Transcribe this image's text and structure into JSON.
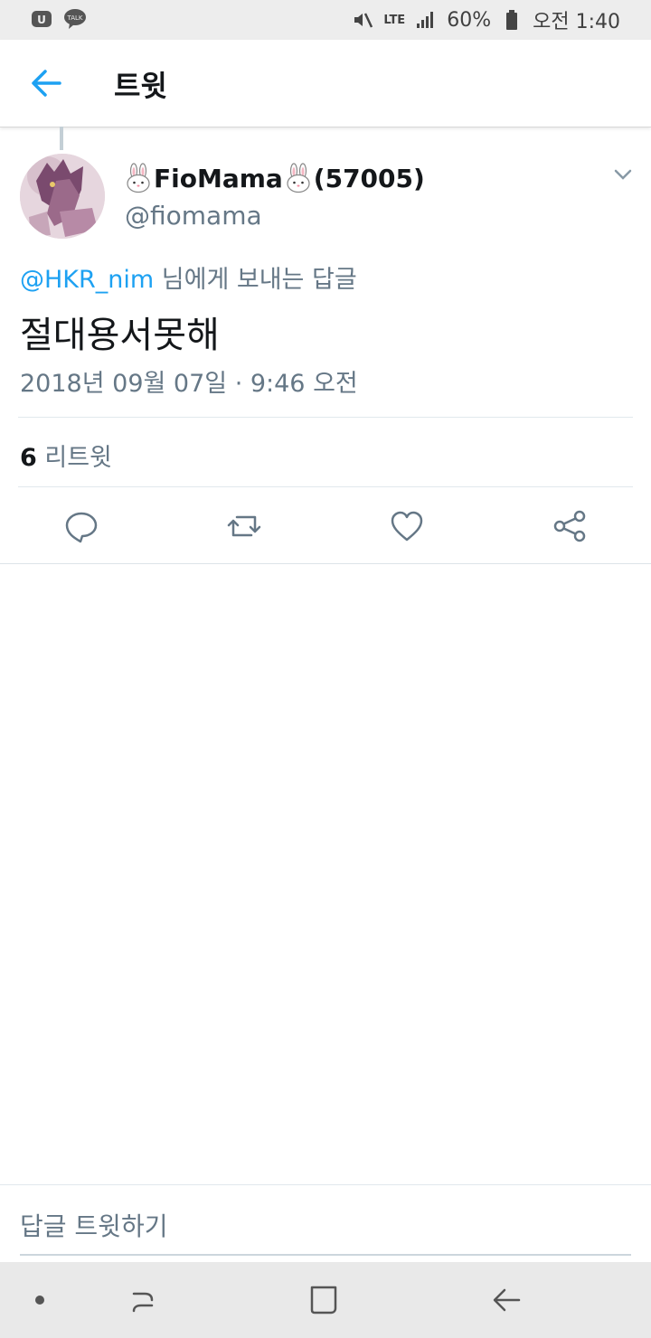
{
  "status_bar": {
    "network": "LTE",
    "battery": "60%",
    "time": "오전 1:40"
  },
  "header": {
    "title": "트윗"
  },
  "tweet": {
    "display_name": "FioMama",
    "display_name_suffix": "(57005)",
    "handle": "@fiomama",
    "reply_to_mention": "@HKR_nim",
    "reply_to_text": " 님에게 보내는 답글",
    "text": "절대용서못해",
    "timestamp": "2018년 09월 07일 · 9:46 오전",
    "retweet_count": "6",
    "retweet_label": " 리트윗"
  },
  "reply_bar": {
    "placeholder": "답글 트윗하기"
  },
  "icons": {
    "back": "arrow-left-icon",
    "caret": "chevron-down-icon",
    "reply": "reply-icon",
    "retweet": "retweet-icon",
    "like": "heart-icon",
    "share": "share-icon"
  },
  "colors": {
    "accent": "#1da1f2",
    "secondary_text": "#657786",
    "primary_text": "#14171a"
  }
}
